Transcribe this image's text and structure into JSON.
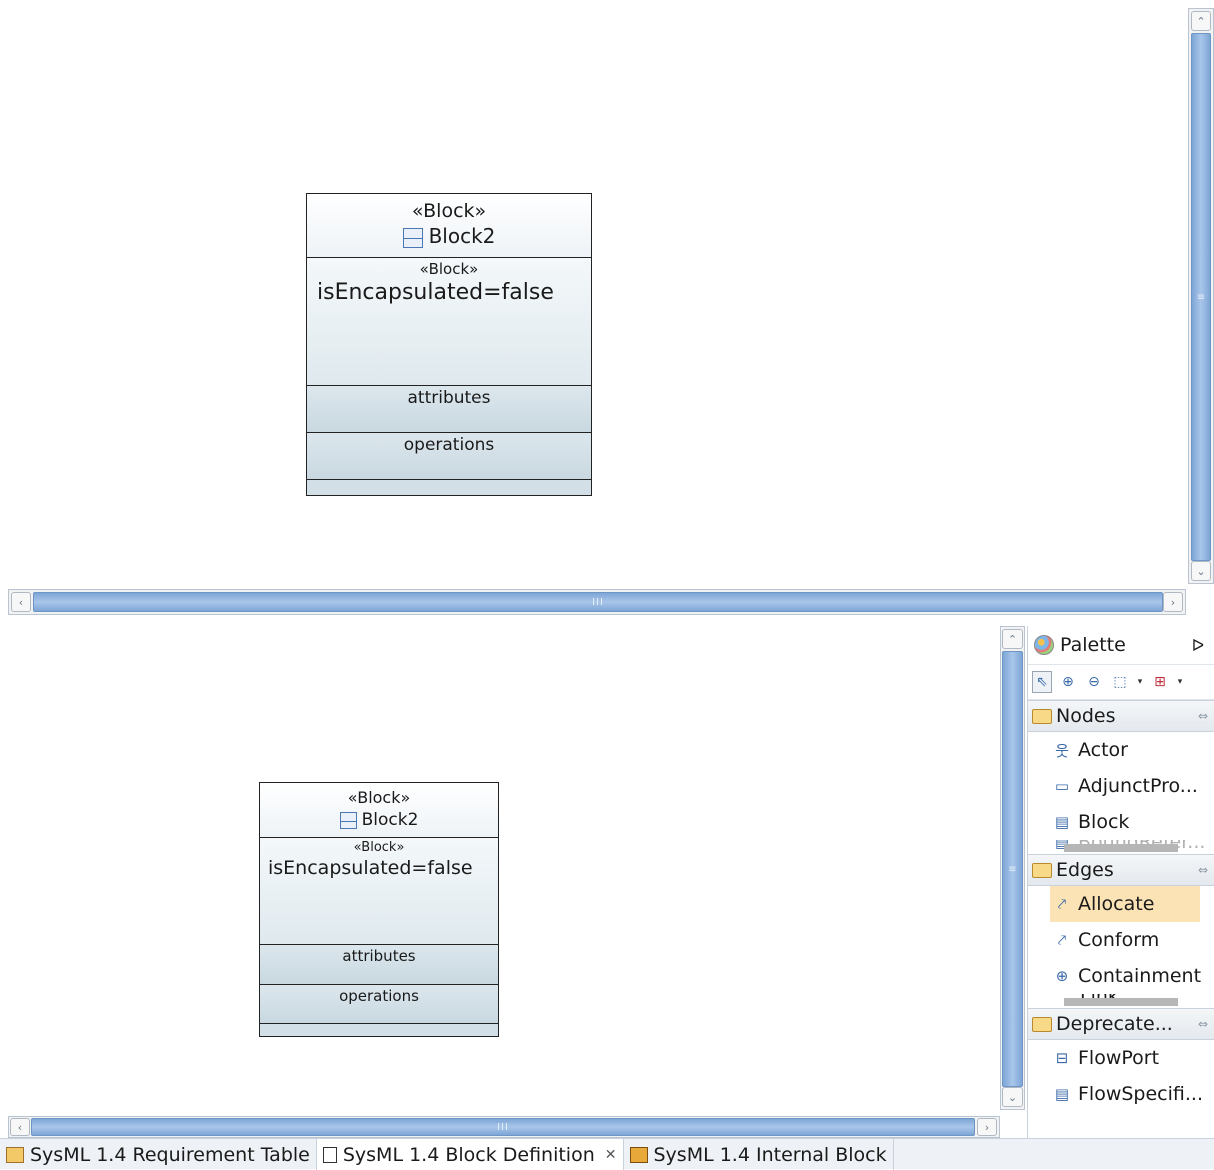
{
  "top_diagram": {
    "block": {
      "stereotype": "«Block»",
      "name": "Block2",
      "body_stereotype": "«Block»",
      "property": "isEncapsulated=false",
      "attributes_label": "attributes",
      "operations_label": "operations"
    }
  },
  "bottom_diagram": {
    "block": {
      "stereotype": "«Block»",
      "name": "Block2",
      "body_stereotype": "«Block»",
      "property": "isEncapsulated=false",
      "attributes_label": "attributes",
      "operations_label": "operations"
    }
  },
  "scrollbars": {
    "grip_v": "≡",
    "grip_h": "III",
    "up": "⌃",
    "down": "⌄",
    "left": "‹",
    "right": "›"
  },
  "palette": {
    "title": "Palette",
    "collapse": "ᐅ",
    "drawers": [
      {
        "label": "Nodes",
        "pin": "⇔",
        "entries": [
          {
            "label": "Actor",
            "icon": "actor-icon"
          },
          {
            "label": "AdjunctPro...",
            "icon": "adjunct-property-icon"
          },
          {
            "label": "Block",
            "icon": "block-icon"
          },
          {
            "label": "BoundRefer...",
            "icon": "bound-reference-icon"
          }
        ]
      },
      {
        "label": "Edges",
        "pin": "⇔",
        "entries": [
          {
            "label": "Allocate",
            "icon": "allocate-icon",
            "selected": true
          },
          {
            "label": "Conform",
            "icon": "conform-icon"
          },
          {
            "label": "Containment",
            "icon": "containment-icon"
          },
          {
            "label": "Link",
            "icon": "link-icon"
          }
        ]
      },
      {
        "label": "Deprecate...",
        "pin": "⇔",
        "entries": [
          {
            "label": "FlowPort",
            "icon": "flowport-icon"
          },
          {
            "label": "FlowSpecifi...",
            "icon": "flow-specification-icon"
          }
        ]
      }
    ]
  },
  "tabs": [
    {
      "label": "SysML 1.4 Requirement Table",
      "icon": "requirement-table-icon",
      "active": false
    },
    {
      "label": "SysML 1.4 Block Definition",
      "icon": "block-definition-icon",
      "active": true,
      "close": "✕"
    },
    {
      "label": "SysML 1.4 Internal Block",
      "icon": "internal-block-icon",
      "active": false
    }
  ]
}
